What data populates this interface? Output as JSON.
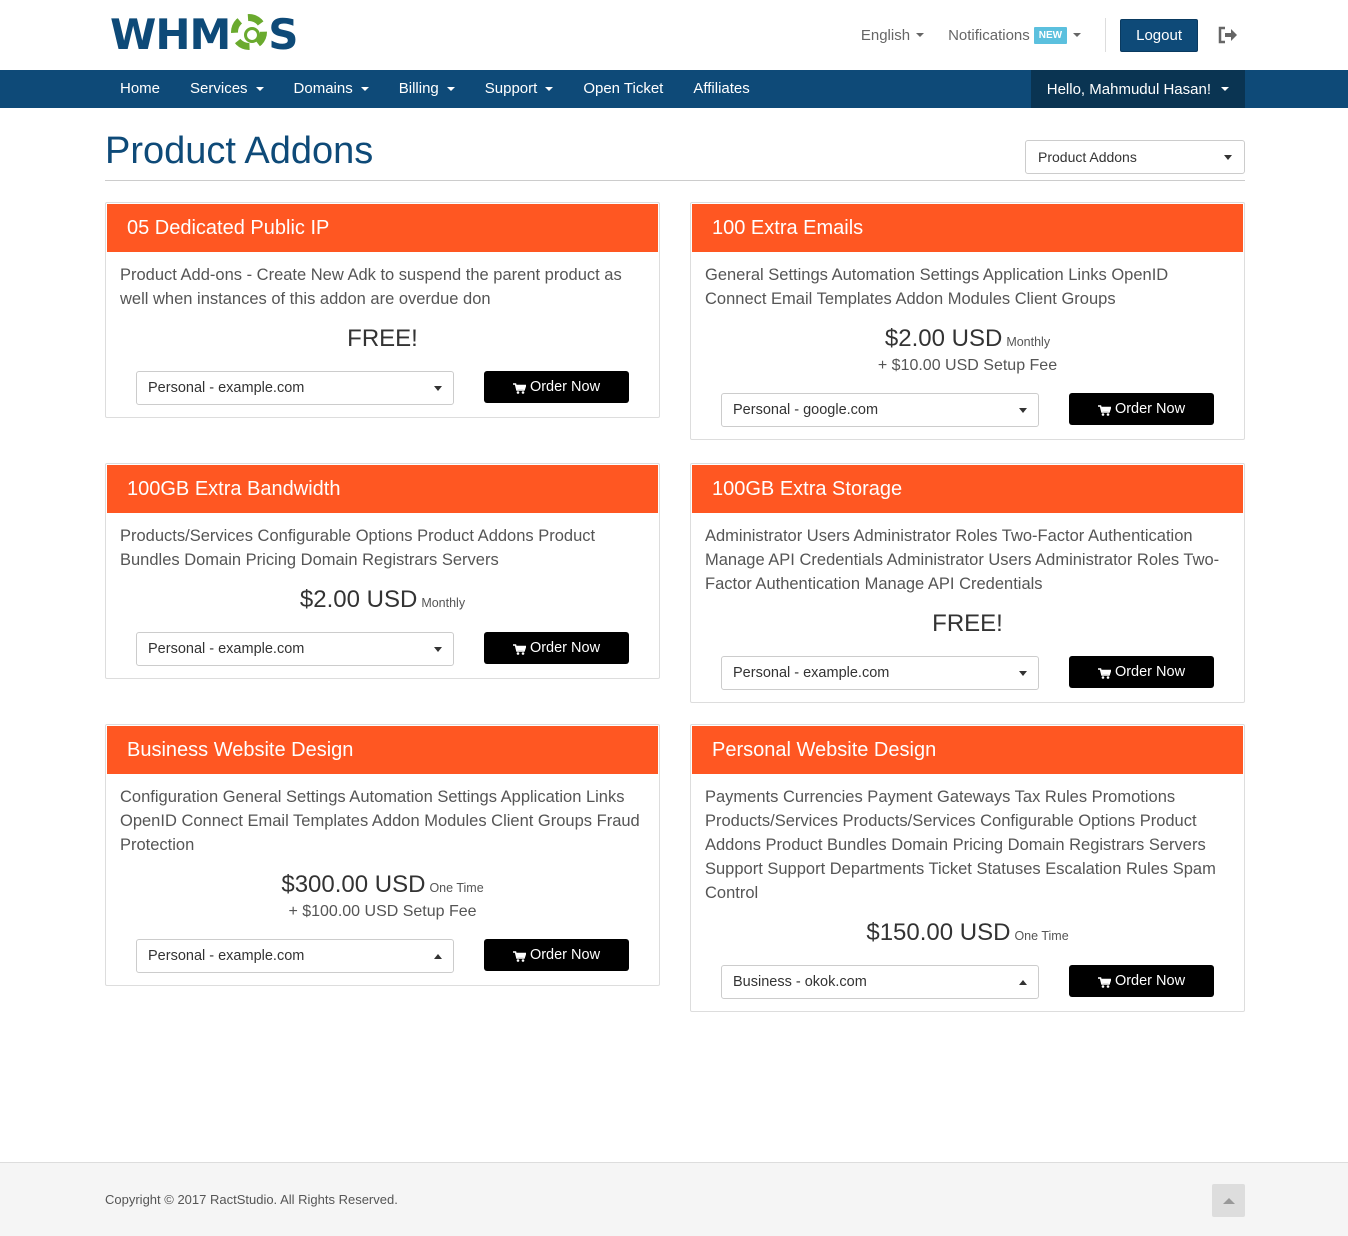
{
  "header": {
    "logo_text_a": "WHM",
    "logo_text_b": "S",
    "language": "English",
    "notifications": "Notifications",
    "notifications_badge": "NEW",
    "logout": "Logout",
    "exit_icon": "sign-out-icon"
  },
  "nav": {
    "items": [
      "Home",
      "Services",
      "Domains",
      "Billing",
      "Support",
      "Open Ticket",
      "Affiliates"
    ],
    "user": "Hello, Mahmudul Hasan!"
  },
  "page": {
    "title": "Product Addons",
    "category_select": "Product Addons"
  },
  "cards": [
    {
      "title": "05 Dedicated Public IP",
      "description": "Product Add-ons - Create New Adk to suspend the parent product as well when instances of this addon are overdue don",
      "price": "FREE!",
      "cycle": "",
      "setup_fee": "",
      "selected": "Personal - example.com",
      "order": "Order Now"
    },
    {
      "title": "100 Extra Emails",
      "description": "General Settings Automation Settings Application Links OpenID Connect Email Templates Addon Modules Client Groups",
      "price": "$2.00 USD",
      "cycle": "Monthly",
      "setup_fee": "+ $10.00 USD Setup Fee",
      "selected": "Personal - google.com",
      "order": "Order Now"
    },
    {
      "title": "100GB Extra Bandwidth",
      "description": "Products/Services Configurable Options Product Addons Product Bundles Domain Pricing Domain Registrars Servers",
      "price": "$2.00 USD",
      "cycle": "Monthly",
      "setup_fee": "",
      "selected": "Personal - example.com",
      "order": "Order Now"
    },
    {
      "title": "100GB Extra Storage",
      "description": "Administrator Users Administrator Roles Two-Factor Authentication Manage API Credentials Administrator Users Administrator Roles Two-Factor Authentication Manage API Credentials",
      "price": "FREE!",
      "cycle": "",
      "setup_fee": "",
      "selected": "Personal - example.com",
      "order": "Order Now"
    },
    {
      "title": "Business Website Design",
      "description": "Configuration General Settings Automation Settings Application Links OpenID Connect Email Templates Addon Modules Client Groups Fraud Protection",
      "price": "$300.00 USD",
      "cycle": "One Time",
      "setup_fee": "+ $100.00 USD Setup Fee",
      "selected": "Personal - example.com",
      "order": "Order Now"
    },
    {
      "title": "Personal Website Design",
      "description": "Payments Currencies Payment Gateways Tax Rules Promotions Products/Services Products/Services Configurable Options Product Addons Product Bundles Domain Pricing Domain Registrars Servers Support Support Departments Ticket Statuses Escalation Rules Spam Control",
      "price": "$150.00 USD",
      "cycle": "One Time",
      "setup_fee": "",
      "selected": "Business - okok.com",
      "order": "Order Now"
    }
  ],
  "footer": {
    "copyright": "Copyright © 2017 RactStudio. All Rights Reserved."
  },
  "colors": {
    "brand": "#0e4a78",
    "card_header": "#ff5722",
    "button": "#000000",
    "badge": "#5bc0de"
  }
}
